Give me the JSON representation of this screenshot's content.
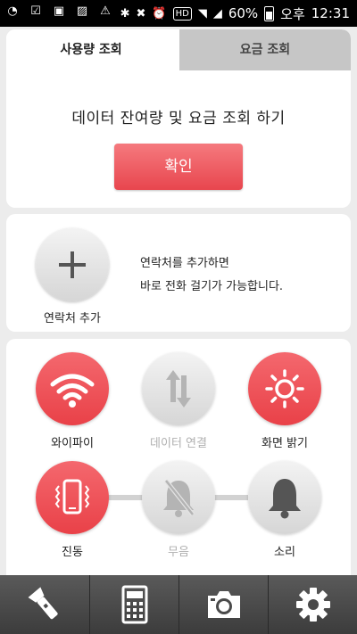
{
  "status_bar": {
    "battery": "60%",
    "ampm": "오후",
    "time": "12:31",
    "hd": "HD"
  },
  "tabs": {
    "usage": "사용량 조회",
    "fee": "요금 조회"
  },
  "usage_card": {
    "headline": "데이터 잔여량 및 요금 조회 하기",
    "confirm_label": "확인"
  },
  "contact_card": {
    "add_label": "연락처 추가",
    "desc_line1": "연락처를 추가하면",
    "desc_line2": "바로 전화 걸기가 가능합니다."
  },
  "controls": {
    "wifi": "와이파이",
    "data": "데이터 연결",
    "brightness": "화면 밝기",
    "vibrate": "진동",
    "mute": "무음",
    "sound": "소리"
  },
  "colors": {
    "accent": "#e9454d",
    "inactive": "#d8d8d8"
  },
  "bottom_bar": [
    "flashlight-icon",
    "calculator-icon",
    "camera-icon",
    "settings-icon"
  ]
}
